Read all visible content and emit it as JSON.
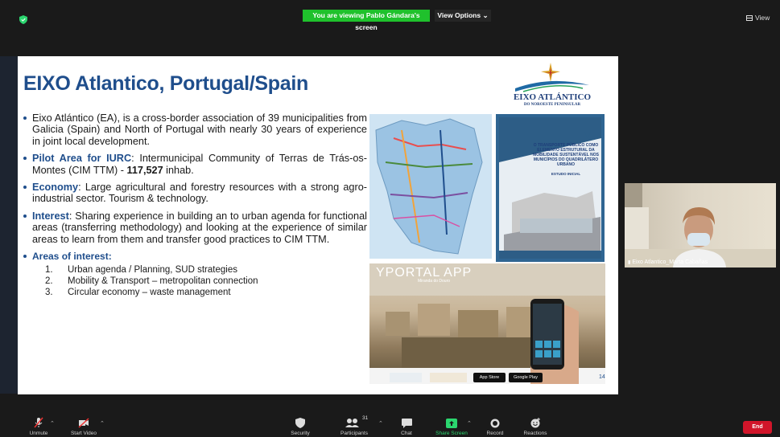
{
  "top_bar": {
    "sharing_banner": "You are viewing Pablo Gándara's screen",
    "view_options": "View Options",
    "view_button": "View"
  },
  "slide": {
    "title": "EIXO Atlantico, Portugal/Spain",
    "logo_title": "EIXO ATLÁNTICO",
    "logo_subtitle": "DO NOROESTE PENINSULAR",
    "bullets": {
      "b1": "Eixo Atlántico (EA), is a cross-border association of 39 municipalities from Galicia (Spain) and North of Portugal with nearly 30 years of experience in joint local development.",
      "b2_label": "Pilot Area for IURC",
      "b2_text": ": Intermunicipal Community of Terras de Trás-os-Montes (CIM TTM) - ",
      "b2_bold": "117,527",
      "b2_tail": " inhab.",
      "b3_label": "Economy",
      "b3_text": ": Large agricultural and forestry resources with a strong agro-industrial sector. Tourism & technology.",
      "b4_label": "Interest",
      "b4_text": ": Sharing experience in building an to urban agenda for functional areas (transferring methodology) and looking at the experience of similar areas to learn from them and transfer good practices to CIM TTM.",
      "b5_label": "Areas of interest:"
    },
    "areas": [
      {
        "num": "1.",
        "text": "Urban agenda / Planning, SUD strategies"
      },
      {
        "num": "2.",
        "text": "Mobility & Transport – metropolitan connection"
      },
      {
        "num": "3.",
        "text": "Circular economy – waste management"
      }
    ],
    "cover_title": "O TRANSPORTE PÚBLICO COMO ELEMENTO ESTRUTURAL DA MOBILIDADE SUSTENTÁVEL NOS MUNICÍPIOS DO QUADRILÁTERO URBANO",
    "cover_subtitle": "ESTUDO INICIAL",
    "portal_title": "YPORTAL APP",
    "portal_subtitle": "Miranda do Douro",
    "app_store": "App Store",
    "google_play": "Google Play",
    "page_number": "14"
  },
  "participant": {
    "name": "Eixo Atlantico_Marta Cabañas"
  },
  "toolbar": {
    "unmute": "Unmute",
    "start_video": "Start Video",
    "security": "Security",
    "participants": "Participants",
    "participants_count": "31",
    "chat": "Chat",
    "share_screen": "Share Screen",
    "record": "Record",
    "reactions": "Reactions",
    "end": "End"
  },
  "colors": {
    "banner_green": "#1fc12c",
    "slide_blue": "#1f4e8c",
    "end_red": "#d1152a",
    "share_green": "#2bd66f"
  }
}
